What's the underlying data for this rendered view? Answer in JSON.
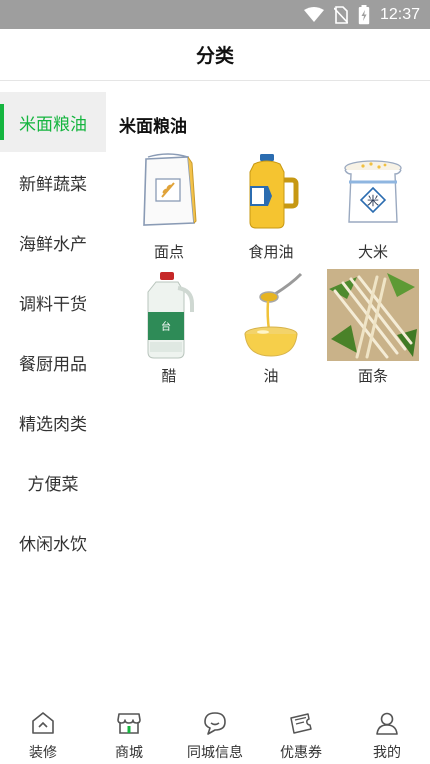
{
  "status_bar": {
    "time": "12:37"
  },
  "header": {
    "title": "分类"
  },
  "sidebar": {
    "items": [
      {
        "label": "米面粮油",
        "active": true
      },
      {
        "label": "新鲜蔬菜",
        "active": false
      },
      {
        "label": "海鲜水产",
        "active": false
      },
      {
        "label": "调料干货",
        "active": false
      },
      {
        "label": "餐厨用品",
        "active": false
      },
      {
        "label": "精选肉类",
        "active": false
      },
      {
        "label": "方便菜",
        "active": false
      },
      {
        "label": "休闲水饮",
        "active": false
      }
    ]
  },
  "content": {
    "section_title": "米面粮油",
    "products": [
      {
        "label": "面点",
        "icon": "flour-bag-icon"
      },
      {
        "label": "食用油",
        "icon": "oil-bottle-icon"
      },
      {
        "label": "大米",
        "icon": "rice-bag-icon"
      },
      {
        "label": "醋",
        "icon": "vinegar-jug-icon"
      },
      {
        "label": "油",
        "icon": "oil-bowl-icon"
      },
      {
        "label": "面条",
        "icon": "noodles-icon"
      }
    ]
  },
  "bottom_nav": {
    "items": [
      {
        "label": "装修",
        "icon": "home-icon"
      },
      {
        "label": "商城",
        "icon": "store-icon"
      },
      {
        "label": "同城信息",
        "icon": "chat-icon"
      },
      {
        "label": "优惠券",
        "icon": "coupon-icon"
      },
      {
        "label": "我的",
        "icon": "user-icon"
      }
    ]
  },
  "colors": {
    "accent": "#15b53f",
    "status_bar": "#9e9e9e",
    "active_bg": "#efefef"
  }
}
